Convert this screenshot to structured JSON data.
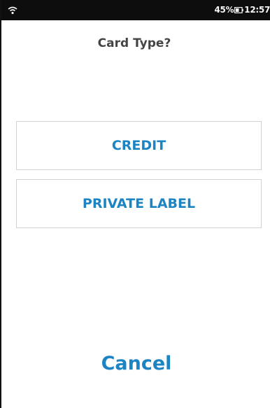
{
  "status_bar": {
    "battery_percent": "45%",
    "time": "12:57"
  },
  "prompt": {
    "title": "Card Type?"
  },
  "options": [
    {
      "label": "CREDIT"
    },
    {
      "label": "PRIVATE LABEL"
    }
  ],
  "actions": {
    "cancel_label": "Cancel"
  },
  "colors": {
    "accent": "#1d84c4",
    "status_bar_bg": "#0d0d0d",
    "title_text": "#444444",
    "button_border": "#d2d2d2"
  },
  "icons": {
    "signal": "wifi-icon",
    "battery": "battery-icon"
  }
}
